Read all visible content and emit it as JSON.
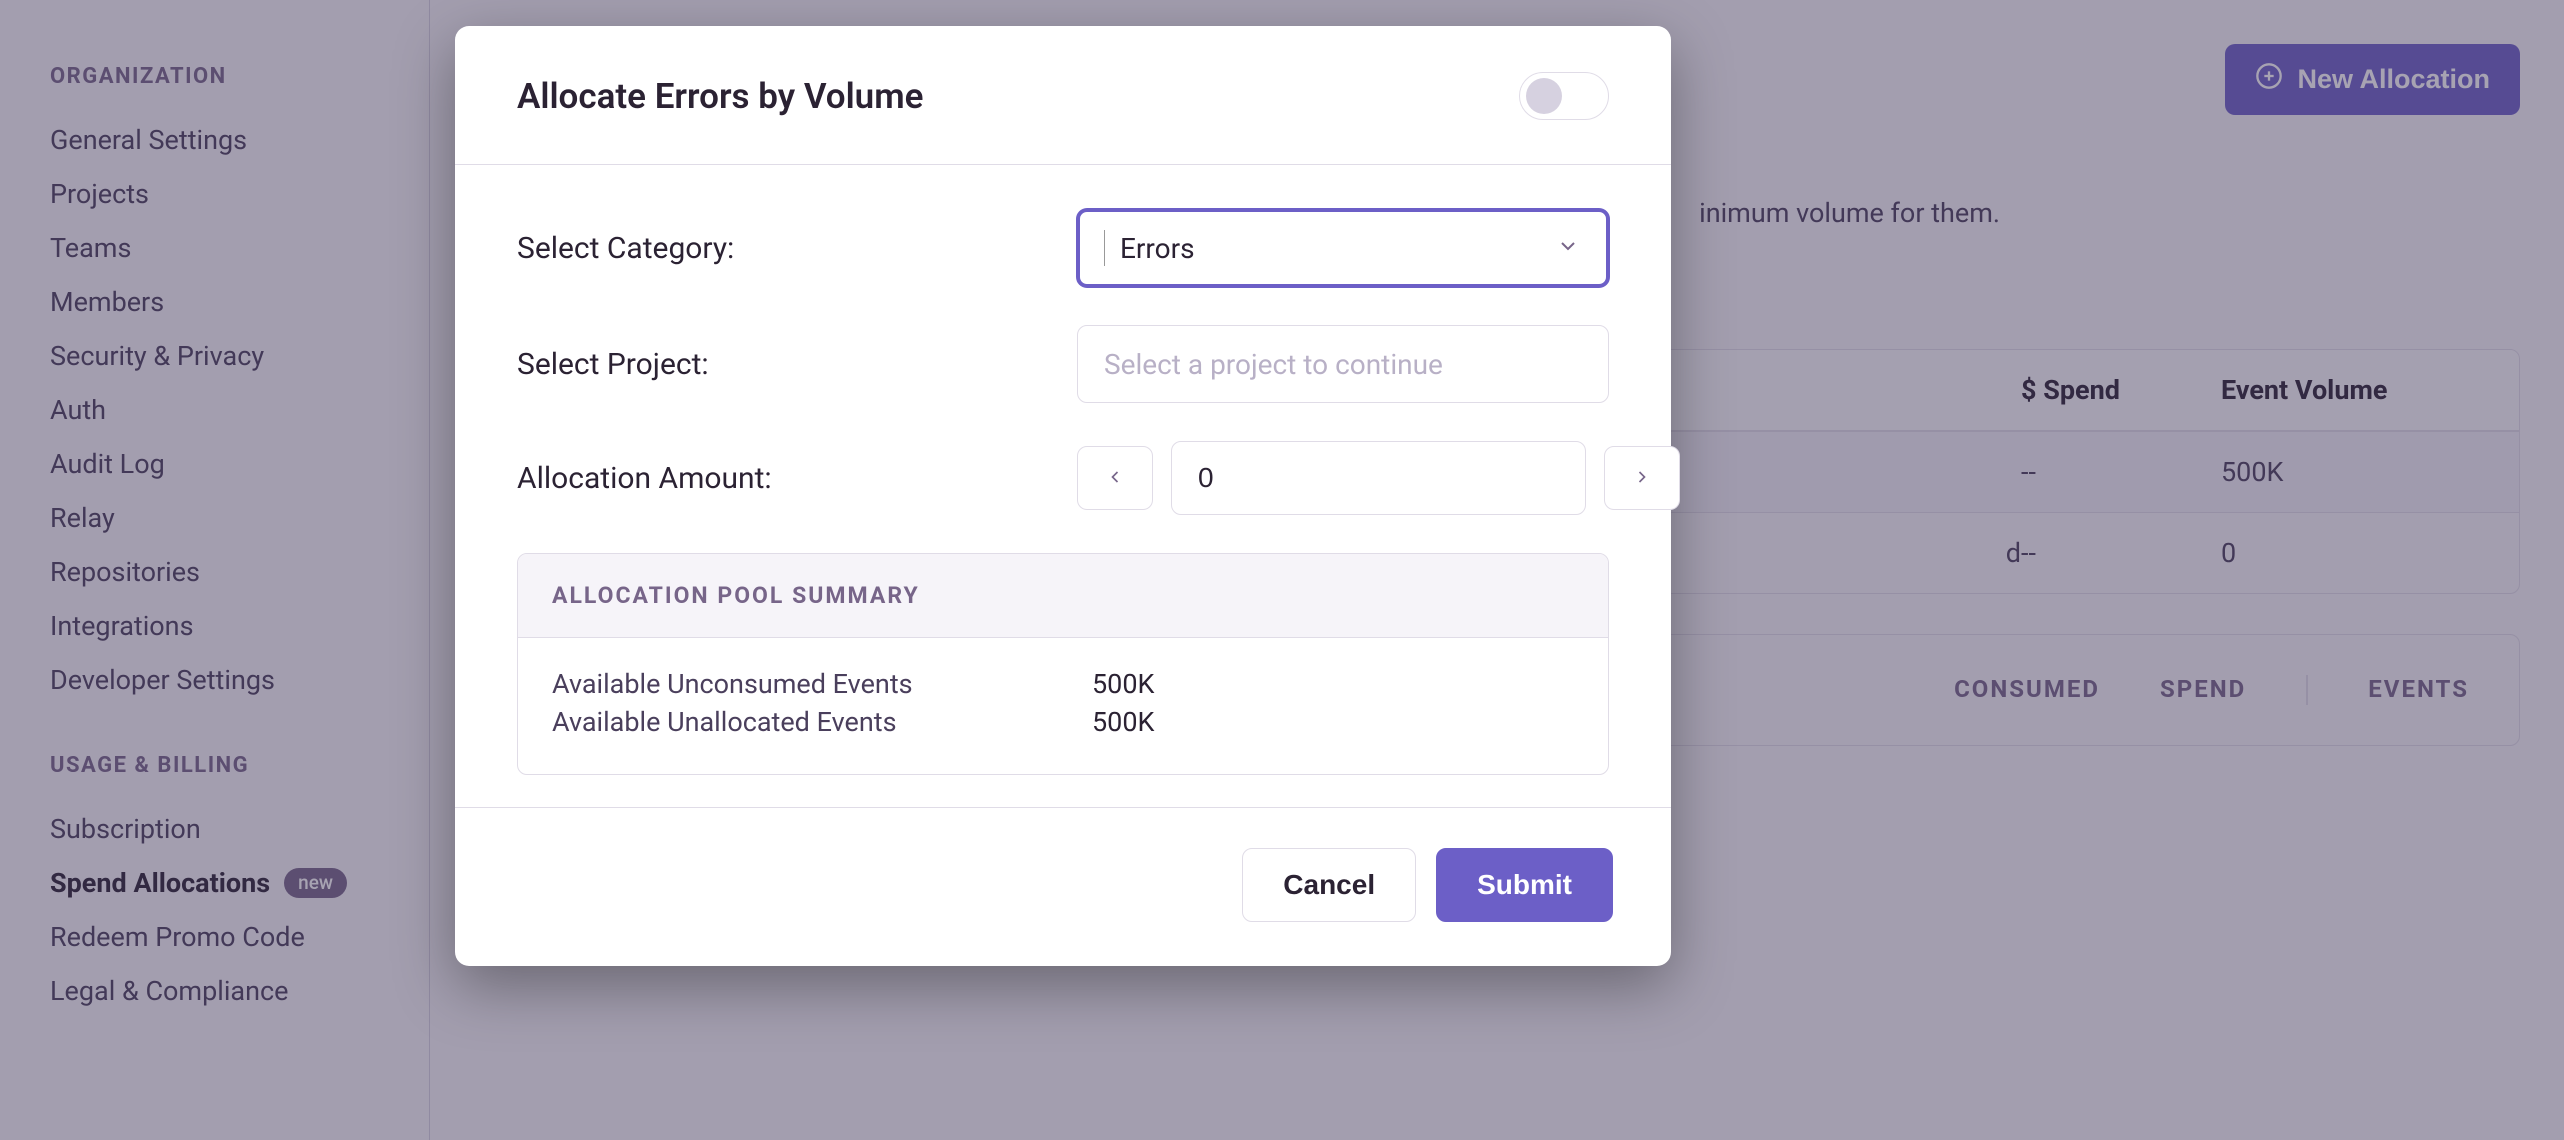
{
  "sidebar": {
    "section1": {
      "title": "ORGANIZATION"
    },
    "items1": [
      {
        "label": "General Settings"
      },
      {
        "label": "Projects"
      },
      {
        "label": "Teams"
      },
      {
        "label": "Members"
      },
      {
        "label": "Security & Privacy"
      },
      {
        "label": "Auth"
      },
      {
        "label": "Audit Log"
      },
      {
        "label": "Relay"
      },
      {
        "label": "Repositories"
      },
      {
        "label": "Integrations"
      },
      {
        "label": "Developer Settings"
      }
    ],
    "section2": {
      "title": "USAGE & BILLING"
    },
    "items2": [
      {
        "label": "Subscription"
      },
      {
        "label": "Spend Allocations",
        "badge": "new",
        "active": true
      },
      {
        "label": "Redeem Promo Code"
      },
      {
        "label": "Legal & Compliance"
      }
    ]
  },
  "main": {
    "new_allocation_label": "New Allocation",
    "hint_tail": "inimum volume for them.",
    "table": {
      "col_spend": "$ Spend",
      "col_volume": "Event Volume",
      "rows": [
        {
          "name_tail": "",
          "spend": "--",
          "volume": "500K"
        },
        {
          "name_tail": "d",
          "spend": "--",
          "volume": "0"
        }
      ]
    },
    "tabs": {
      "consumed": "CONSUMED",
      "spend": "SPEND",
      "events": "EVENTS"
    }
  },
  "modal": {
    "title": "Allocate Errors by Volume",
    "toggle_on": false,
    "category_label": "Select Category:",
    "category_value": "Errors",
    "project_label": "Select Project:",
    "project_placeholder": "Select a project to continue",
    "amount_label": "Allocation Amount:",
    "amount_value": "0",
    "pool": {
      "title": "ALLOCATION POOL SUMMARY",
      "lines": [
        {
          "label": "Available Unconsumed Events",
          "value": "500K"
        },
        {
          "label": "Available Unallocated Events",
          "value": "500K"
        }
      ]
    },
    "cancel": "Cancel",
    "submit": "Submit"
  }
}
